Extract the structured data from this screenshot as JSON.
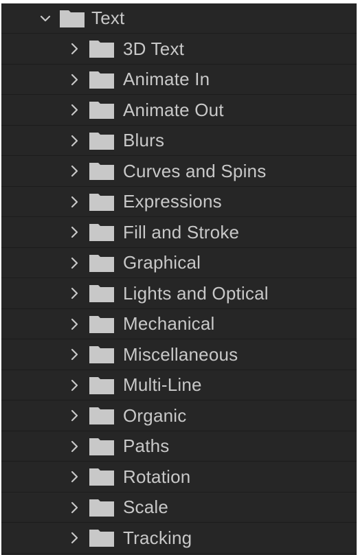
{
  "tree": {
    "parent": {
      "label": "Text",
      "expanded": true,
      "icon": "folder-icon",
      "chevron_icon": "chevron-down-icon"
    },
    "children": [
      {
        "label": "3D Text"
      },
      {
        "label": "Animate In"
      },
      {
        "label": "Animate Out"
      },
      {
        "label": "Blurs"
      },
      {
        "label": "Curves and Spins"
      },
      {
        "label": "Expressions"
      },
      {
        "label": "Fill and Stroke"
      },
      {
        "label": "Graphical"
      },
      {
        "label": "Lights and Optical"
      },
      {
        "label": "Mechanical"
      },
      {
        "label": "Miscellaneous"
      },
      {
        "label": "Multi-Line"
      },
      {
        "label": "Organic"
      },
      {
        "label": "Paths"
      },
      {
        "label": "Rotation"
      },
      {
        "label": "Scale"
      },
      {
        "label": "Tracking"
      }
    ]
  },
  "colors": {
    "panel_background": "#262626",
    "text": "#c8c8c8",
    "folder": "#c8c8c8",
    "chevron": "#c8c8c8"
  }
}
